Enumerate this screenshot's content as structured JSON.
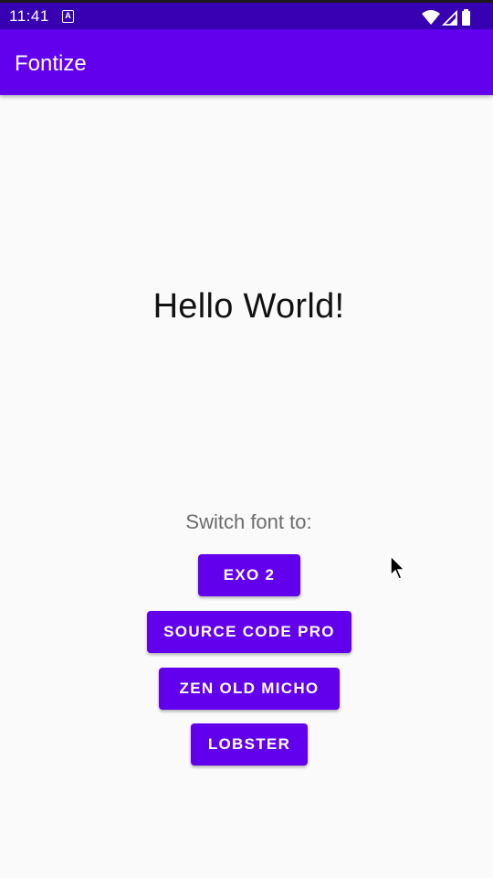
{
  "status_bar": {
    "time": "11:41",
    "notification_glyph": "A",
    "icons": [
      "wifi-icon",
      "signal-icon",
      "battery-icon"
    ]
  },
  "app_bar": {
    "title": "Fontize"
  },
  "main": {
    "hello_text": "Hello World!",
    "switch_label": "Switch font to:",
    "buttons": [
      {
        "label": "EXO 2"
      },
      {
        "label": "SOURCE CODE PRO"
      },
      {
        "label": "ZEN OLD MICHO"
      },
      {
        "label": "LOBSTER"
      }
    ]
  },
  "colors": {
    "primary": "#6200ee",
    "primary_dark": "#3700b3",
    "background": "#fafafa",
    "on_primary": "#ffffff"
  }
}
